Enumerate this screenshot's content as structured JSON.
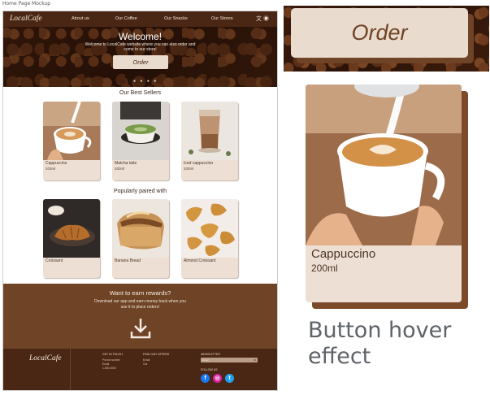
{
  "mockup_label": "Home Page Mockup",
  "nav": {
    "logo": "LocalCafe",
    "links": [
      "About us",
      "Our Coffee",
      "Our Snacks",
      "Our Stores"
    ],
    "translate_icon": "translate-icon",
    "account_icon": "account-icon"
  },
  "hero": {
    "title": "Welcome!",
    "subtitle": "Welcome to LocalCafe website where you can also order and come to our store!",
    "button": "Order",
    "carousel_dots": "● ● ● ●"
  },
  "best_sellers": {
    "title": "Our Best Sellers",
    "items": [
      {
        "name": "Cappuccino",
        "size": "200ml"
      },
      {
        "name": "Matcha latte",
        "size": "200ml"
      },
      {
        "name": "Iced cappuccino",
        "size": "200ml"
      }
    ]
  },
  "paired": {
    "title": "Popularly paired with",
    "items": [
      {
        "name": "Croissant"
      },
      {
        "name": "Banana Bread"
      },
      {
        "name": "Almond Croissant"
      }
    ]
  },
  "rewards": {
    "title": "Want to earn rewards?",
    "text": "Download our app and earn money back when you use it to place orders!",
    "icon": "download-icon"
  },
  "footer": {
    "logo": "LocalCafe",
    "col1_head": "GET IN TOUCH",
    "col1_lines": [
      "Phone number",
      "Email",
      "1-800-0000"
    ],
    "col2_head": "FIND OUR OFFERS",
    "col2_lines": [
      "Email",
      "Our"
    ],
    "newsletter_head": "NEWSLETTER",
    "email_placeholder": "Email",
    "follow_head": "FOLLOW US",
    "social": [
      "f",
      "◎",
      "t"
    ]
  },
  "hover_demo": {
    "button": "Order",
    "card_name": "Cappuccino",
    "card_size": "200ml",
    "caption": "Button hover effect"
  },
  "colors": {
    "dark_brown": "#4a2614",
    "mid_brown": "#6f4326",
    "cream": "#e9dbcd",
    "card": "#eddfd3"
  }
}
